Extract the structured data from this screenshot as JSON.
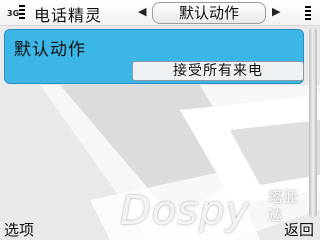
{
  "statusbar": {
    "network": "3G"
  },
  "header": {
    "app_title": "电话精灵",
    "tab_label": "默认动作",
    "prev_arrow": "◀",
    "next_arrow": "▶"
  },
  "setting": {
    "label": "默认动作",
    "value": "接受所有来电"
  },
  "watermark": {
    "text": "Dospy",
    "cn_top": "塔亚",
    "cn_bottom": "达"
  },
  "softkeys": {
    "left": "选项",
    "right": "返回"
  },
  "colors": {
    "accent": "#3cb6e6",
    "background": "#e9e9e9"
  }
}
